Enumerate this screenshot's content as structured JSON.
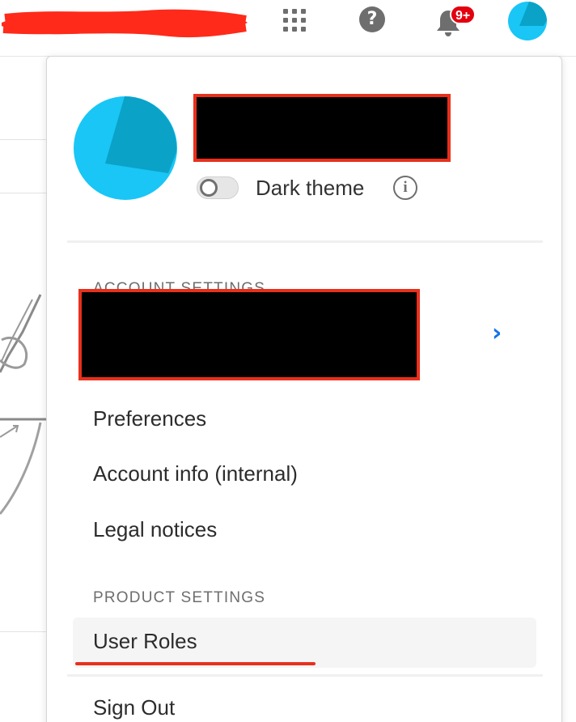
{
  "header": {
    "notification_count": "9+",
    "colors": {
      "badge": "#e3000f",
      "avatar_light": "#19c6f6",
      "avatar_dark": "#0ba2c8",
      "accent_blue": "#1473e6",
      "redaction_border": "#e8301c"
    },
    "icons": [
      "apps-grid-icon",
      "help-icon",
      "bell-icon",
      "avatar-icon"
    ]
  },
  "profile": {
    "dark_theme_label": "Dark theme",
    "dark_theme_enabled": false
  },
  "menu": {
    "account_section_label": "ACCOUNT SETTINGS",
    "account_items": [
      "Preferences",
      "Account info (internal)",
      "Legal notices"
    ],
    "product_section_label": "PRODUCT SETTINGS",
    "product_items": [
      "User Roles"
    ],
    "sign_out_label": "Sign Out"
  }
}
